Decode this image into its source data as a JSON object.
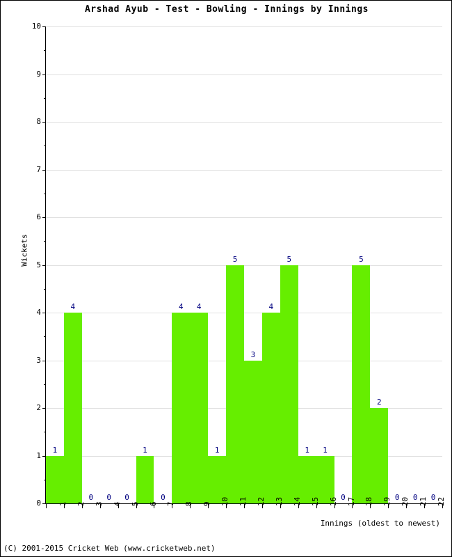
{
  "chart_data": {
    "type": "bar",
    "title": "Arshad Ayub - Test - Bowling - Innings by Innings",
    "xlabel": "Innings (oldest to newest)",
    "ylabel": "Wickets",
    "categories": [
      "1",
      "2",
      "3",
      "4",
      "5",
      "6",
      "7",
      "8",
      "9",
      "10",
      "11",
      "12",
      "13",
      "14",
      "15",
      "16",
      "17",
      "18",
      "19",
      "20",
      "21",
      "22"
    ],
    "values": [
      1,
      4,
      0,
      0,
      0,
      1,
      0,
      4,
      4,
      1,
      5,
      3,
      4,
      5,
      1,
      1,
      0,
      5,
      2,
      0,
      0,
      0
    ],
    "data_labels": [
      "1",
      "4",
      "0",
      "0",
      "0",
      "1",
      "0",
      "4",
      "4",
      "1",
      "5",
      "3",
      "4",
      "5",
      "1",
      "1",
      "0",
      "5",
      "2",
      "0",
      "0",
      "0"
    ],
    "ylim": [
      0,
      10
    ],
    "yticks": [
      0,
      1,
      2,
      3,
      4,
      5,
      6,
      7,
      8,
      9,
      10
    ],
    "ytick_labels": [
      "0",
      "1",
      "2",
      "3",
      "4",
      "5",
      "6",
      "7",
      "8",
      "9",
      "10"
    ],
    "grid": true,
    "legend": false,
    "bar_color": "#66ee00",
    "label_color": "#000080",
    "grid_color": "#e0e0e0",
    "axis_color": "#000000"
  },
  "footer": {
    "copyright": "(C) 2001-2015 Cricket Web (www.cricketweb.net)"
  }
}
